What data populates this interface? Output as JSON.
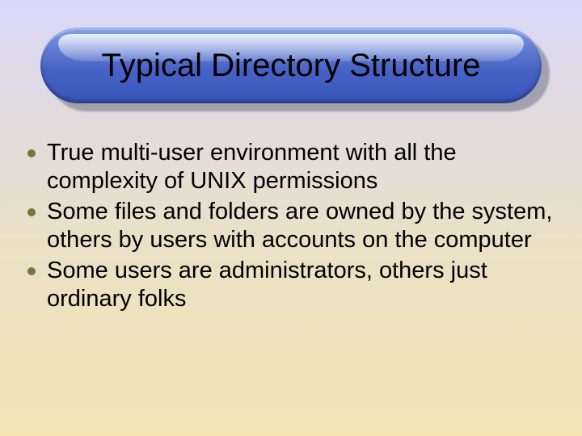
{
  "title": "Typical Directory Structure",
  "bullets": {
    "b0": "True multi-user environment with all the complexity of UNIX permissions",
    "b1": "Some files and folders are owned by the system, others by users with accounts on the computer",
    "b2": "Some users are administrators, others just ordinary folks"
  }
}
